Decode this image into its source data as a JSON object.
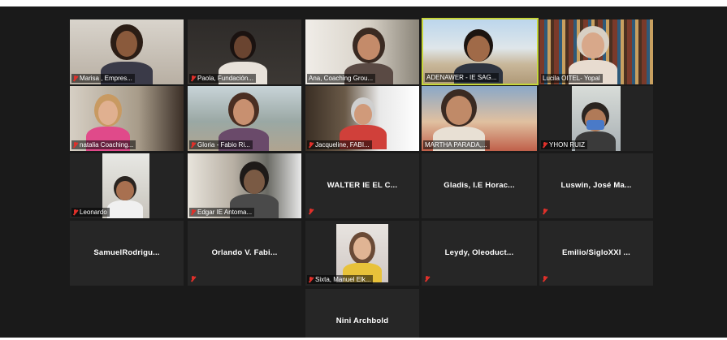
{
  "meeting": {
    "participants": [
      {
        "name": "Marisa , Empres...",
        "muted": true
      },
      {
        "name": "Paola, Fundación...",
        "muted": true
      },
      {
        "name": "Ana, Coaching Grou...",
        "muted": false
      },
      {
        "name": "ADENAWER - IE SAG...",
        "muted": false,
        "active_speaker": true
      },
      {
        "name": "Lucila OITEL- Yopal",
        "muted": false
      },
      {
        "name": "natalia Coaching...",
        "muted": true
      },
      {
        "name": "Gloria - Fabio Ri...",
        "muted": true
      },
      {
        "name": "Jacqueline, FABI...",
        "muted": true
      },
      {
        "name": "MARTHA PARADA,...",
        "muted": false
      },
      {
        "name": "YHON RUIZ",
        "muted": true
      },
      {
        "name": "Leonardo",
        "muted": true
      },
      {
        "name": "Edgar IE Antoma...",
        "muted": true
      },
      {
        "name": "WALTER IE EL C...",
        "muted": true
      },
      {
        "name": "Gladis, I.E Horac...",
        "muted": false
      },
      {
        "name": "Luswin, José Ma...",
        "muted": true
      },
      {
        "name": "SamuelRodrigu...",
        "muted": false
      },
      {
        "name": "Orlando V. Fabi...",
        "muted": true
      },
      {
        "name": "Sixta, Manuel Elk...",
        "muted": true
      },
      {
        "name": "Leydy, Oleoduct...",
        "muted": true
      },
      {
        "name": "Emilio/SigloXXI ...",
        "muted": true
      },
      {
        "name": "Nini Archbold",
        "muted": false
      }
    ]
  },
  "colors": {
    "background": "#1a1a1a",
    "tile": "#262626",
    "active_speaker_border": "#c7d63a",
    "muted_icon": "#e0302a"
  }
}
